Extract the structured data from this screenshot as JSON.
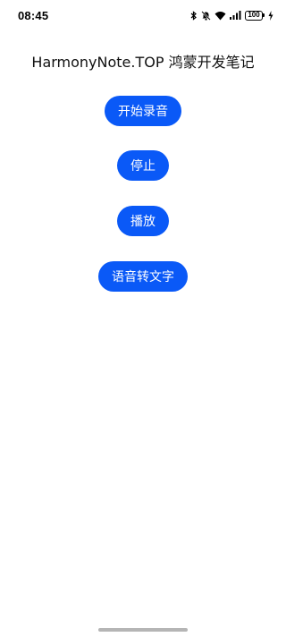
{
  "status_bar": {
    "time": "08:45",
    "battery": "100",
    "icons": [
      "bluetooth-icon",
      "mute-icon",
      "wifi-icon",
      "signal-icon",
      "battery-icon",
      "charging-icon"
    ]
  },
  "title": "HarmonyNote.TOP  鸿蒙开发笔记",
  "buttons": {
    "start_record": "开始录音",
    "stop": "停止",
    "play": "播放",
    "speech_to_text": "语音转文字"
  },
  "colors": {
    "accent": "#0a59f7",
    "background": "#ffffff"
  }
}
